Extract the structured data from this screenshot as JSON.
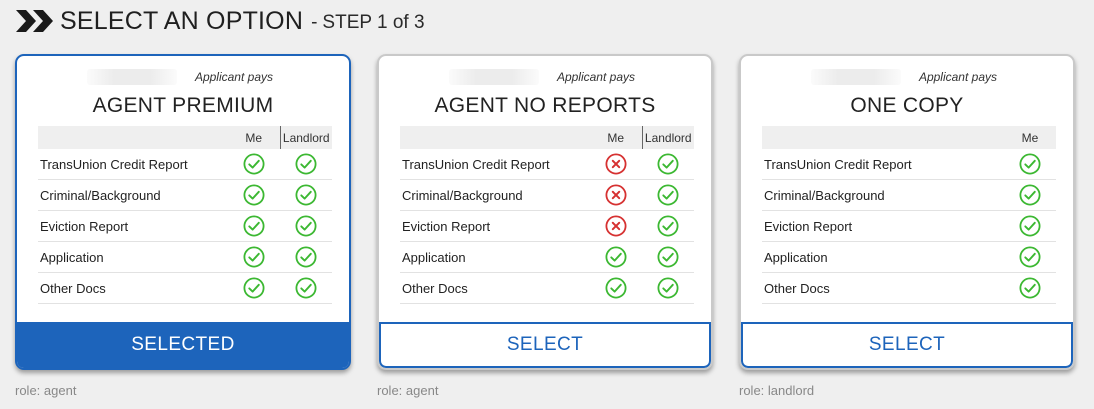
{
  "header": {
    "title": "SELECT AN OPTION",
    "step_dash": "-",
    "step": "STEP 1 of 3"
  },
  "colors": {
    "accent": "#1d64bb",
    "check": "#3cb832",
    "cross": "#d63131"
  },
  "cards": [
    {
      "payer": "Applicant pays",
      "name": "AGENT PREMIUM",
      "col_me": "Me",
      "col_landlord": "Landlord",
      "rows": [
        {
          "label": "TransUnion Credit Report",
          "me": "check",
          "landlord": "check"
        },
        {
          "label": "Criminal/Background",
          "me": "check",
          "landlord": "check"
        },
        {
          "label": "Eviction Report",
          "me": "check",
          "landlord": "check"
        },
        {
          "label": "Application",
          "me": "check",
          "landlord": "check"
        },
        {
          "label": "Other Docs",
          "me": "check",
          "landlord": "check"
        }
      ],
      "button_label": "SELECTED",
      "selected": true,
      "role": "role: agent"
    },
    {
      "payer": "Applicant pays",
      "name": "AGENT NO REPORTS",
      "col_me": "Me",
      "col_landlord": "Landlord",
      "rows": [
        {
          "label": "TransUnion Credit Report",
          "me": "cross",
          "landlord": "check"
        },
        {
          "label": "Criminal/Background",
          "me": "cross",
          "landlord": "check"
        },
        {
          "label": "Eviction Report",
          "me": "cross",
          "landlord": "check"
        },
        {
          "label": "Application",
          "me": "check",
          "landlord": "check"
        },
        {
          "label": "Other Docs",
          "me": "check",
          "landlord": "check"
        }
      ],
      "button_label": "SELECT",
      "selected": false,
      "role": "role: agent"
    },
    {
      "payer": "Applicant pays",
      "name": "ONE COPY",
      "col_me": "Me",
      "rows": [
        {
          "label": "TransUnion Credit Report",
          "me": "check"
        },
        {
          "label": "Criminal/Background",
          "me": "check"
        },
        {
          "label": "Eviction Report",
          "me": "check"
        },
        {
          "label": "Application",
          "me": "check"
        },
        {
          "label": "Other Docs",
          "me": "check"
        }
      ],
      "button_label": "SELECT",
      "selected": false,
      "role": "role: landlord"
    }
  ]
}
